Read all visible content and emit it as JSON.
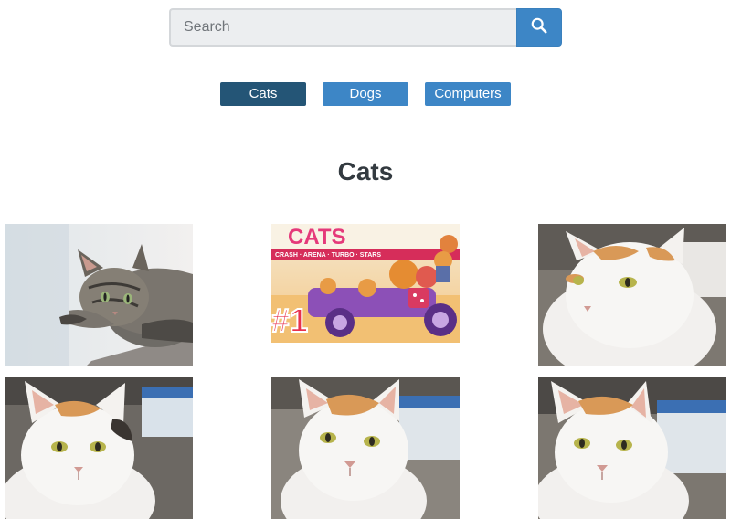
{
  "search": {
    "placeholder": "Search",
    "button_icon": "search-icon"
  },
  "tabs": [
    {
      "label": "Cats",
      "active": true
    },
    {
      "label": "Dogs",
      "active": false
    },
    {
      "label": "Computers",
      "active": false
    }
  ],
  "heading": "Cats",
  "colors": {
    "accent": "#3d86c6",
    "active_tab": "#245576"
  },
  "images": [
    {
      "subject": "tabby cat lying down"
    },
    {
      "subject": "game cover art with cartoon cats in a vehicle",
      "visible_text": [
        "CATS",
        "CRASH · ARENA · TURBO · STARS",
        "#1"
      ]
    },
    {
      "subject": "white and orange cat"
    },
    {
      "subject": "white and orange cat"
    },
    {
      "subject": "white and orange cat"
    },
    {
      "subject": "white and orange cat"
    }
  ]
}
